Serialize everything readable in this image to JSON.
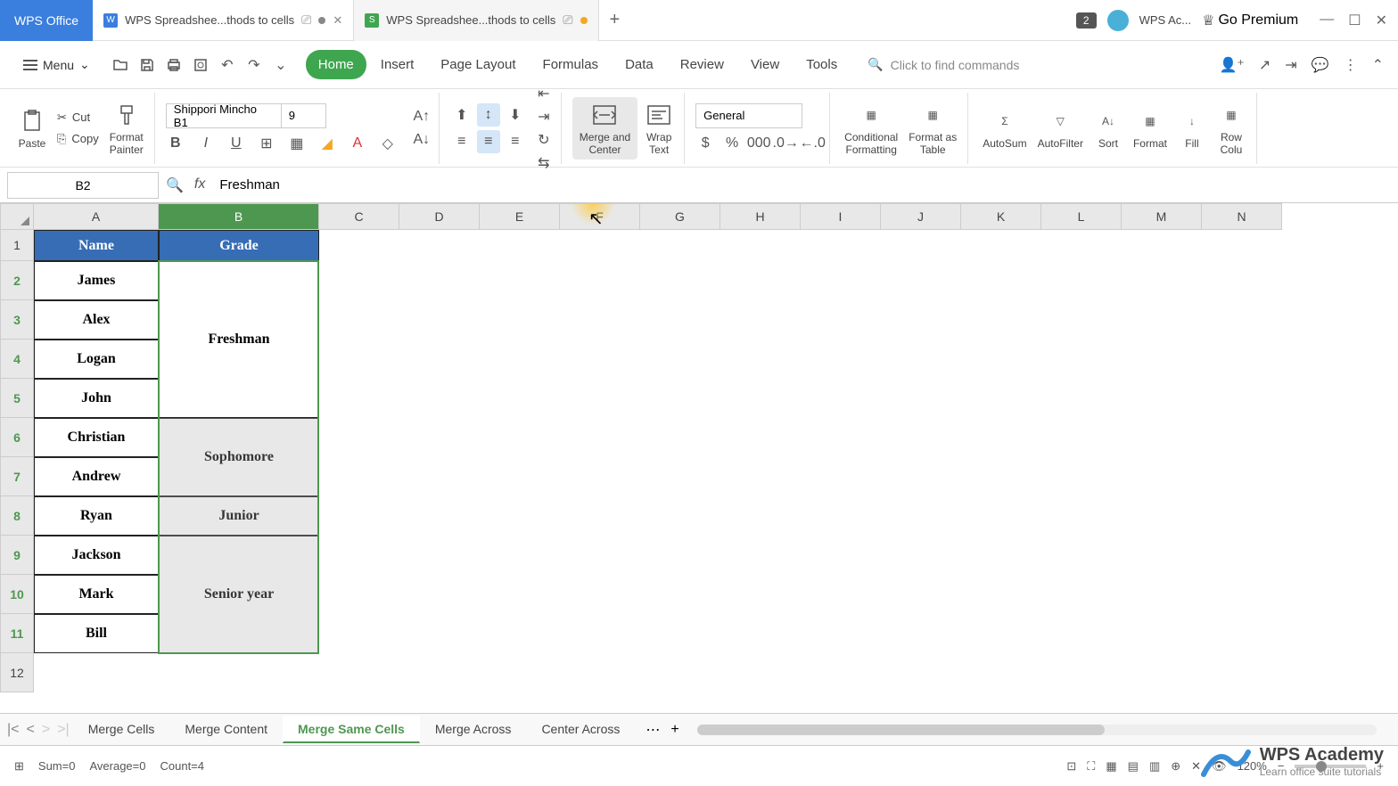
{
  "app": {
    "name": "WPS Office"
  },
  "tabs": [
    {
      "icon": "W",
      "label": "WPS Spreadshee...thods to cells",
      "active": false,
      "modified": false
    },
    {
      "icon": "S",
      "label": "WPS Spreadshee...thods to cells",
      "active": true,
      "modified": true
    }
  ],
  "titlebar": {
    "badge_count": "2",
    "user": "WPS Ac...",
    "premium": "Go Premium"
  },
  "menu": {
    "label": "Menu"
  },
  "ribbon_tabs": [
    "Home",
    "Insert",
    "Page Layout",
    "Formulas",
    "Data",
    "Review",
    "View",
    "Tools"
  ],
  "active_ribbon_tab": "Home",
  "search_placeholder": "Click to find commands",
  "ribbon": {
    "paste": "Paste",
    "cut": "Cut",
    "copy": "Copy",
    "format_painter": "Format\nPainter",
    "font_name": "Shippori Mincho B1",
    "font_size": "9",
    "merge_center": "Merge and\nCenter",
    "wrap_text": "Wrap\nText",
    "number_format": "General",
    "conditional_formatting": "Conditional\nFormatting",
    "format_table": "Format as\nTable",
    "autosum": "AutoSum",
    "autofilter": "AutoFilter",
    "sort": "Sort",
    "format": "Format",
    "fill": "Fill",
    "row_col": "Row\nColu"
  },
  "name_box": "B2",
  "formula_value": "Freshman",
  "columns": [
    "A",
    "B",
    "C",
    "D",
    "E",
    "F",
    "G",
    "H",
    "I",
    "J",
    "K",
    "L",
    "M",
    "N"
  ],
  "col_widths": {
    "A": 140,
    "B": 180,
    "rest": 90
  },
  "rows": [
    "1",
    "2",
    "3",
    "4",
    "5",
    "6",
    "7",
    "8",
    "9",
    "10",
    "11",
    "12"
  ],
  "headers": {
    "A1": "Name",
    "B1": "Grade"
  },
  "names": [
    "James",
    "Alex",
    "Logan",
    "John",
    "Christian",
    "Andrew",
    "Ryan",
    "Jackson",
    "Mark",
    "Bill"
  ],
  "grades": [
    {
      "label": "Freshman",
      "rowspan": 4,
      "start": 2
    },
    {
      "label": "Sophomore",
      "rowspan": 2,
      "start": 6
    },
    {
      "label": "Junior",
      "rowspan": 1,
      "start": 8
    },
    {
      "label": "Senior year",
      "rowspan": 3,
      "start": 9
    }
  ],
  "sheet_tabs": [
    "Merge Cells",
    "Merge Content",
    "Merge Same Cells",
    "Merge Across",
    "Center Across"
  ],
  "active_sheet": "Merge Same Cells",
  "status": {
    "sum": "Sum=0",
    "avg": "Average=0",
    "count": "Count=4",
    "zoom": "120%"
  },
  "academy": {
    "title": "WPS Academy",
    "sub": "Learn office suite tutorials"
  }
}
